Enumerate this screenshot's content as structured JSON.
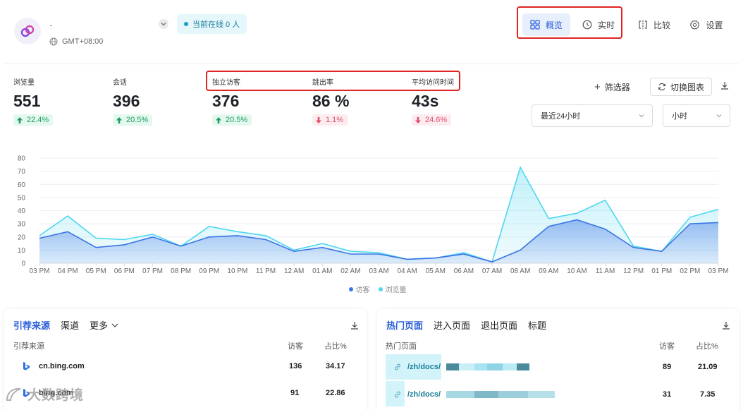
{
  "header": {
    "site_name": "·",
    "timezone": "GMT+08:00",
    "online": "当前在线 0 人",
    "nav": {
      "overview": "概览",
      "realtime": "实时",
      "compare": "比较",
      "settings": "设置"
    }
  },
  "metrics": [
    {
      "label": "浏览量",
      "value": "551",
      "change": "22.4%",
      "direction": "up"
    },
    {
      "label": "会话",
      "value": "396",
      "change": "20.5%",
      "direction": "up"
    },
    {
      "label": "独立访客",
      "value": "376",
      "change": "20.5%",
      "direction": "up"
    },
    {
      "label": "跳出率",
      "value": "86 %",
      "change": "1.1%",
      "direction": "down"
    },
    {
      "label": "平均访问时间",
      "value": "43s",
      "change": "24.6%",
      "direction": "down"
    }
  ],
  "controls": {
    "filter": "筛选器",
    "switch_chart": "切换图表",
    "range": "最近24小时",
    "unit": "小时"
  },
  "chart_data": {
    "type": "area",
    "x": [
      "03 PM",
      "04 PM",
      "05 PM",
      "06 PM",
      "07 PM",
      "08 PM",
      "09 PM",
      "10 PM",
      "11 PM",
      "12 AM",
      "01 AM",
      "02 AM",
      "03 AM",
      "04 AM",
      "05 AM",
      "06 AM",
      "07 AM",
      "08 AM",
      "09 AM",
      "10 AM",
      "11 AM",
      "12 PM",
      "01 PM",
      "02 PM",
      "03 PM"
    ],
    "ylim": [
      0,
      80
    ],
    "yticks": [
      0,
      10,
      20,
      30,
      40,
      50,
      60,
      70,
      80
    ],
    "grid": true,
    "legend_position": "bottom",
    "series": [
      {
        "name": "访客",
        "color": "#3b74e6",
        "values": [
          19,
          24,
          12,
          14,
          20,
          13,
          20,
          21,
          18,
          9,
          12,
          7,
          7,
          3,
          4,
          7,
          1,
          10,
          28,
          33,
          26,
          12,
          9,
          30,
          31
        ]
      },
      {
        "name": "浏览量",
        "color": "#4fd6ef",
        "values": [
          21,
          36,
          19,
          18,
          22,
          13,
          28,
          24,
          21,
          10,
          15,
          9,
          8,
          3,
          4,
          8,
          1,
          73,
          34,
          38,
          48,
          13,
          9,
          35,
          41
        ]
      }
    ]
  },
  "referrers": {
    "tabs": [
      "引荐来源",
      "渠道",
      "更多"
    ],
    "headers": {
      "source": "引荐来源",
      "visitors": "访客",
      "share": "占比%"
    },
    "rows": [
      {
        "name": "cn.bing.com",
        "visitors": "136",
        "share": "34.17"
      },
      {
        "name": "bing.com",
        "visitors": "91",
        "share": "22.86"
      }
    ]
  },
  "pages": {
    "tabs": [
      "热门页面",
      "进入页面",
      "退出页面",
      "标题"
    ],
    "headers": {
      "page": "热门页面",
      "visitors": "访客",
      "share": "占比%"
    },
    "rows": [
      {
        "path": "/zh/docs/",
        "visitors": "89",
        "share": "21.09"
      },
      {
        "path": "/zh/docs/",
        "visitors": "31",
        "share": "7.35"
      }
    ]
  },
  "watermark": "大数跨境",
  "colors": {
    "accent": "#2b5fd9",
    "visitors": "#3b74e6",
    "pageviews": "#4fd6ef",
    "up": "#1e9e5f",
    "down": "#e0506e",
    "highlight_box": "#e02424"
  }
}
